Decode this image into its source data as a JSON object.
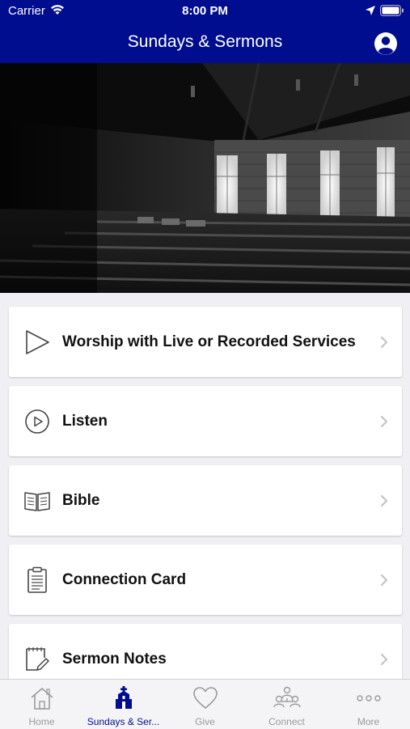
{
  "status_bar": {
    "carrier": "Carrier",
    "time": "8:00 PM"
  },
  "nav": {
    "title": "Sundays & Sermons",
    "profile_icon": "person-circle-icon"
  },
  "hero": {
    "icon": "church-interior-photo"
  },
  "menu": {
    "items": [
      {
        "label": "Worship with Live or Recorded Services",
        "icon": "play-triangle-icon"
      },
      {
        "label": "Listen",
        "icon": "play-circle-icon"
      },
      {
        "label": "Bible",
        "icon": "open-book-icon"
      },
      {
        "label": "Connection Card",
        "icon": "clipboard-icon"
      },
      {
        "label": "Sermon Notes",
        "icon": "notepad-pencil-icon"
      }
    ]
  },
  "tabbar": {
    "tabs": [
      {
        "label": "Home",
        "icon": "house-icon",
        "active": false
      },
      {
        "label": "Sundays & Ser...",
        "icon": "church-icon",
        "active": true
      },
      {
        "label": "Give",
        "icon": "heart-icon",
        "active": false
      },
      {
        "label": "Connect",
        "icon": "people-icon",
        "active": false
      },
      {
        "label": "More",
        "icon": "ellipsis-icon",
        "active": false
      }
    ]
  },
  "colors": {
    "header_bg": "#000d8f",
    "active_tab": "#000d8f",
    "inactive_tab": "#9a9a9e",
    "page_bg": "#efeff4"
  }
}
